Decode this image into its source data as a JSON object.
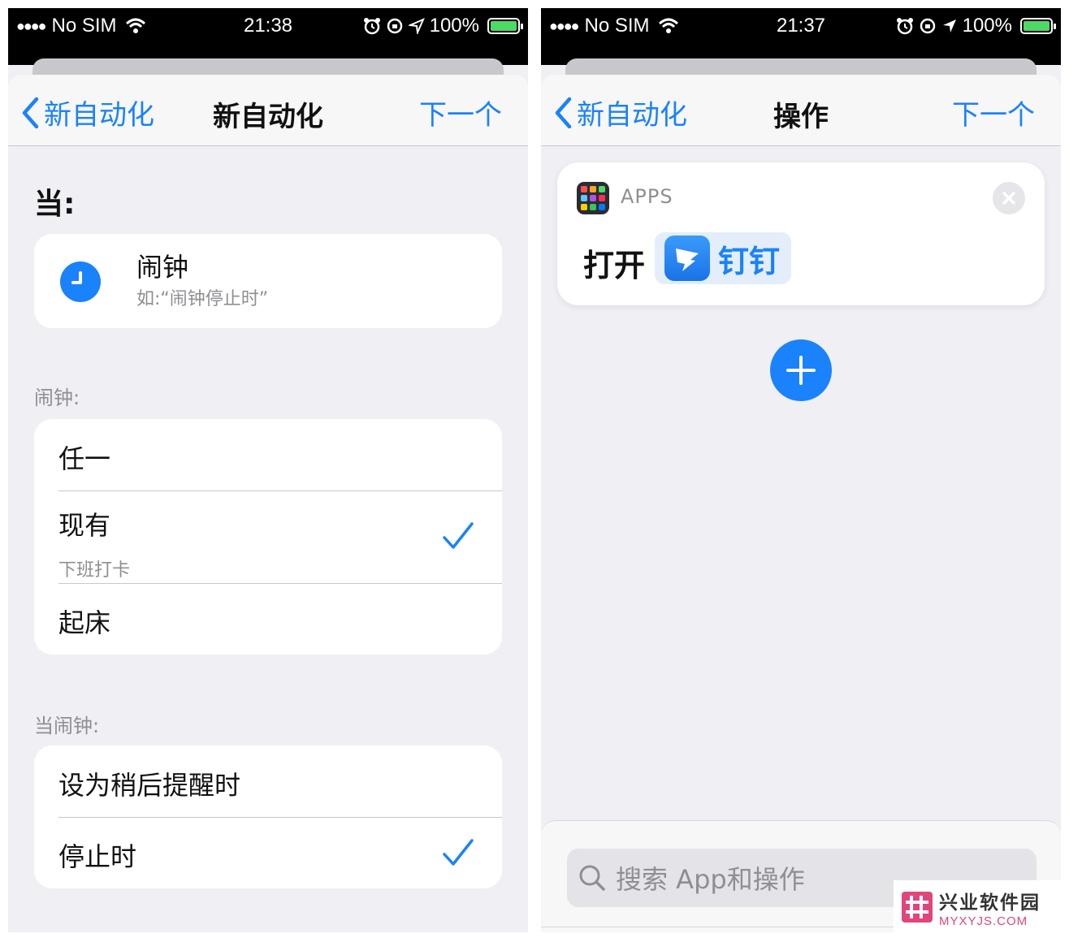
{
  "left_screen": {
    "status": {
      "carrier": "No SIM",
      "time": "21:38",
      "battery": "100%"
    },
    "nav": {
      "back_label": "新自动化",
      "title": "新自动化",
      "next_label": "下一个"
    },
    "when_label": "当:",
    "trigger": {
      "title": "闹钟",
      "subtitle": "如:“闹钟停止时”"
    },
    "alarm_section": {
      "header": "闹钟:",
      "rows": [
        {
          "label": "任一",
          "sub": "",
          "checked": false
        },
        {
          "label": "现有",
          "sub": "下班打卡",
          "checked": true
        },
        {
          "label": "起床",
          "sub": "",
          "checked": false
        }
      ]
    },
    "when_alarm_section": {
      "header": "当闹钟:",
      "rows": [
        {
          "label": "设为稍后提醒时",
          "checked": false
        },
        {
          "label": "停止时",
          "checked": true
        }
      ]
    }
  },
  "right_screen": {
    "status": {
      "carrier": "No SIM",
      "time": "21:37",
      "battery": "100%"
    },
    "nav": {
      "back_label": "新自动化",
      "title": "操作",
      "next_label": "下一个"
    },
    "action": {
      "category": "APPS",
      "verb": "打开",
      "app_name": "钉钉"
    },
    "search": {
      "placeholder": "搜索 App和操作"
    }
  },
  "watermark": {
    "name": "兴业软件园",
    "domain": "MYXYJS.COM"
  },
  "colors": {
    "accent": "#1a82fb",
    "background": "#efeff4",
    "secondary_text": "#8e8e93",
    "battery": "#4cd964"
  }
}
